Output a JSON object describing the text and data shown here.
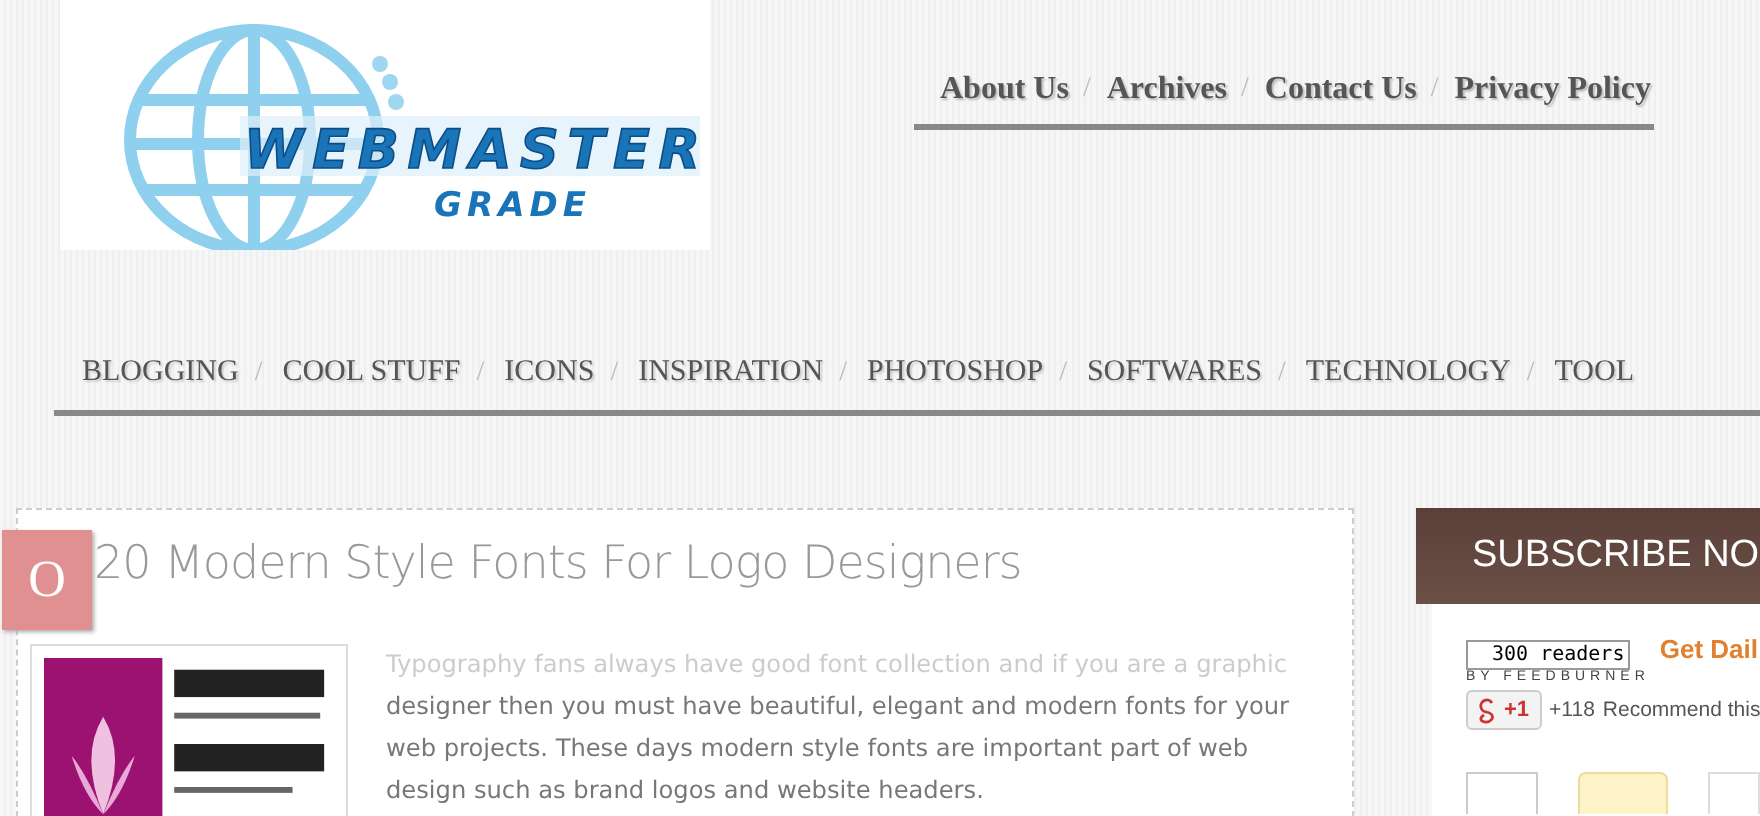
{
  "logo": {
    "title": "WEBMASTER",
    "subtitle": "GRADE"
  },
  "separator": "/",
  "top_nav": [
    {
      "label": "About Us"
    },
    {
      "label": "Archives"
    },
    {
      "label": "Contact Us"
    },
    {
      "label": "Privacy Policy"
    }
  ],
  "categories": [
    {
      "label": "BLOGGING"
    },
    {
      "label": "COOL STUFF"
    },
    {
      "label": "ICONS"
    },
    {
      "label": "INSPIRATION"
    },
    {
      "label": "PHOTOSHOP"
    },
    {
      "label": "SOFTWARES"
    },
    {
      "label": "TECHNOLOGY"
    },
    {
      "label": "TOOL"
    }
  ],
  "post": {
    "date_tab": "O",
    "title": "20 Modern Style Fonts For Logo Designers",
    "excerpt": "Typography fans always have good font collection and if you are a graphic designer then you must have beautiful, elegant and modern fonts for your web projects. These days modern style fonts are important part of web design such as brand logos and website headers."
  },
  "sidebar": {
    "title": "SUBSCRIBE NO",
    "reader_count": "300 readers",
    "feed_credit": "BY FEEDBURNER",
    "get_daily": "Get Dail",
    "plus_button": "+1",
    "plus_count": "+118",
    "recommend": "Recommend this"
  }
}
